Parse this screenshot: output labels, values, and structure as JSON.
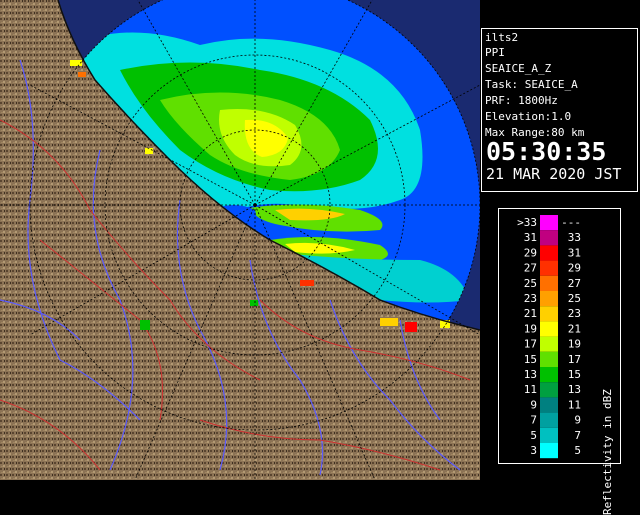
{
  "info": {
    "site": "ilts2",
    "product": "PPI",
    "task_name": "SEAICE_A_Z",
    "task": "Task: SEAICE_A",
    "prf": "PRF: 1800Hz",
    "elevation": "Elevation:1.0",
    "max_range": "Max Range:80 km",
    "time": "05:30:35",
    "date": "21 MAR 2020 JST"
  },
  "legend": {
    "title": "Reflectivity in dBZ",
    "rows": [
      {
        "lo": ">33",
        "hi": "---",
        "color": "#ff00ff"
      },
      {
        "lo": "31",
        "hi": "33",
        "color": "#c00080"
      },
      {
        "lo": "29",
        "hi": "31",
        "color": "#ff0000"
      },
      {
        "lo": "27",
        "hi": "29",
        "color": "#ff3000"
      },
      {
        "lo": "25",
        "hi": "27",
        "color": "#ff7000"
      },
      {
        "lo": "23",
        "hi": "25",
        "color": "#ffa000"
      },
      {
        "lo": "21",
        "hi": "23",
        "color": "#ffd000"
      },
      {
        "lo": "19",
        "hi": "21",
        "color": "#ffff00"
      },
      {
        "lo": "17",
        "hi": "19",
        "color": "#c0ff00"
      },
      {
        "lo": "15",
        "hi": "17",
        "color": "#60e000"
      },
      {
        "lo": "13",
        "hi": "15",
        "color": "#00c000"
      },
      {
        "lo": "11",
        "hi": "13",
        "color": "#00a040"
      },
      {
        "lo": "9",
        "hi": "11",
        "color": "#008080"
      },
      {
        "lo": "7",
        "hi": "9",
        "color": "#00a0a0"
      },
      {
        "lo": "5",
        "hi": "7",
        "color": "#00c0c0"
      },
      {
        "lo": "3",
        "hi": "5",
        "color": "#00ffff"
      }
    ]
  },
  "colors": {
    "land": "#8b7355",
    "sea_in_range": "#0050ff",
    "out_of_range": "#1a2a70",
    "rivers": "#5a5aff",
    "borders": "#d03030"
  }
}
